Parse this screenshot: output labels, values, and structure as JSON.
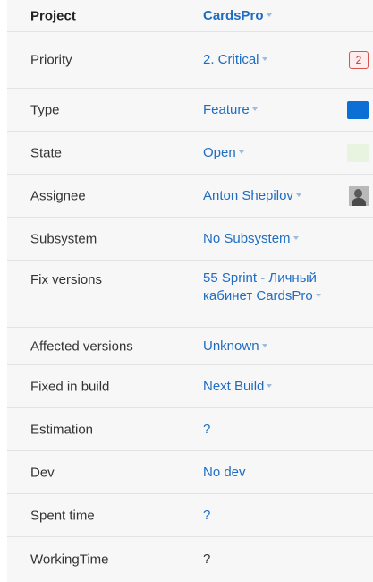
{
  "fields": [
    {
      "label": "Project",
      "value": "CardsPro",
      "dropdown": true
    },
    {
      "label": "Priority",
      "value": "2. Critical",
      "dropdown": true,
      "badge": "2"
    },
    {
      "label": "Type",
      "value": "Feature",
      "dropdown": true,
      "swatch_color": "#0b6fd6"
    },
    {
      "label": "State",
      "value": "Open",
      "dropdown": true,
      "swatch_color": "#e8f3e0"
    },
    {
      "label": "Assignee",
      "value": "Anton Shepilov",
      "dropdown": true,
      "avatar_icon": "user-avatar-icon"
    },
    {
      "label": "Subsystem",
      "value": "No Subsystem",
      "dropdown": true
    },
    {
      "label": "Fix versions",
      "value_line1": "55 Sprint - Личный",
      "value_line2": "кабинет CardsPro",
      "dropdown": true
    },
    {
      "label": "Affected versions",
      "value": "Unknown",
      "dropdown": true
    },
    {
      "label": "Fixed in build",
      "value": "Next Build",
      "dropdown": true
    },
    {
      "label": "Estimation",
      "value": "?"
    },
    {
      "label": "Dev",
      "value": "No dev"
    },
    {
      "label": "Spent time",
      "value": "?"
    },
    {
      "label": "WorkingTime",
      "value": "?"
    }
  ],
  "colors": {
    "link": "#1f6dc2",
    "panel_background": "#f7f7f7",
    "badge_border": "#d9534f"
  }
}
